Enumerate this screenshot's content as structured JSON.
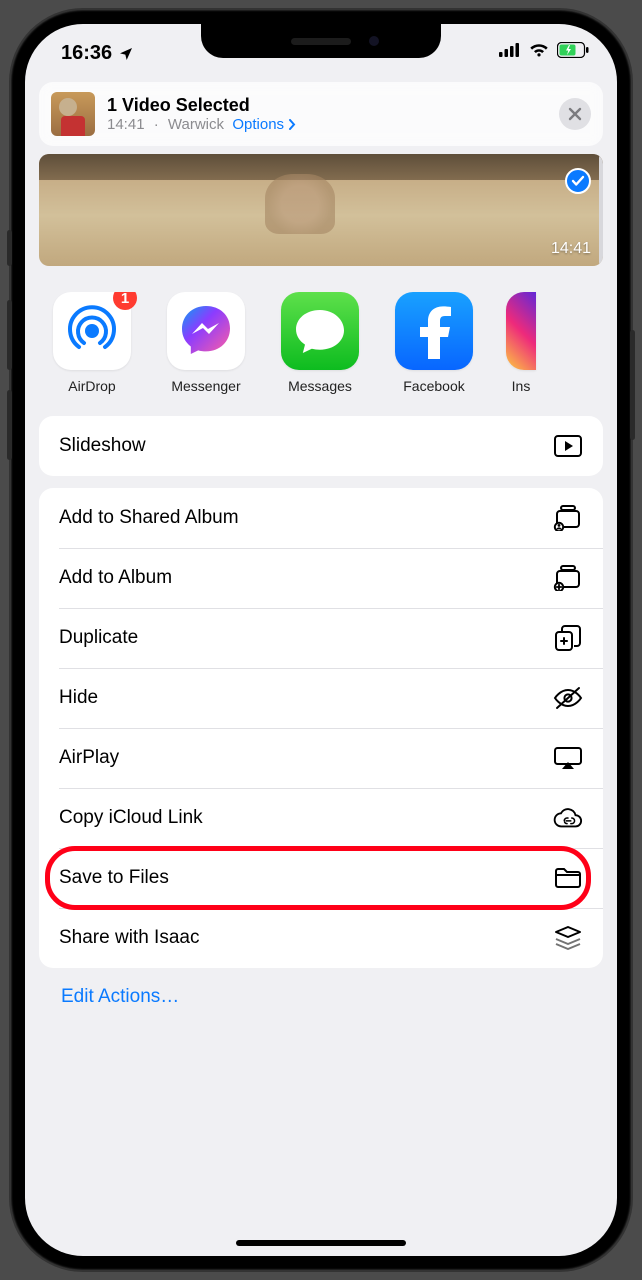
{
  "status": {
    "time": "16:36",
    "location_icon": "location-arrow"
  },
  "header": {
    "title": "1 Video Selected",
    "time": "14:41",
    "separator": "·",
    "location": "Warwick",
    "options_label": "Options"
  },
  "preview": {
    "selected": true,
    "duration": "14:41"
  },
  "apps": [
    {
      "id": "airdrop",
      "label": "AirDrop",
      "badge": "1"
    },
    {
      "id": "messenger",
      "label": "Messenger",
      "badge": null
    },
    {
      "id": "messages",
      "label": "Messages",
      "badge": null
    },
    {
      "id": "facebook",
      "label": "Facebook",
      "badge": null
    },
    {
      "id": "instagram",
      "label": "Ins",
      "badge": null
    }
  ],
  "actions_group1": [
    {
      "id": "slideshow",
      "label": "Slideshow",
      "icon": "play-rect"
    }
  ],
  "actions_group2": [
    {
      "id": "add-shared-album",
      "label": "Add to Shared Album",
      "icon": "shared-album"
    },
    {
      "id": "add-album",
      "label": "Add to Album",
      "icon": "add-album"
    },
    {
      "id": "duplicate",
      "label": "Duplicate",
      "icon": "duplicate"
    },
    {
      "id": "hide",
      "label": "Hide",
      "icon": "eye-slash"
    },
    {
      "id": "airplay",
      "label": "AirPlay",
      "icon": "airplay"
    },
    {
      "id": "copy-icloud",
      "label": "Copy iCloud Link",
      "icon": "cloud-link"
    },
    {
      "id": "save-files",
      "label": "Save to Files",
      "icon": "folder",
      "highlighted": true
    },
    {
      "id": "share-isaac",
      "label": "Share with Isaac",
      "icon": "stack"
    }
  ],
  "edit_actions_label": "Edit Actions…"
}
